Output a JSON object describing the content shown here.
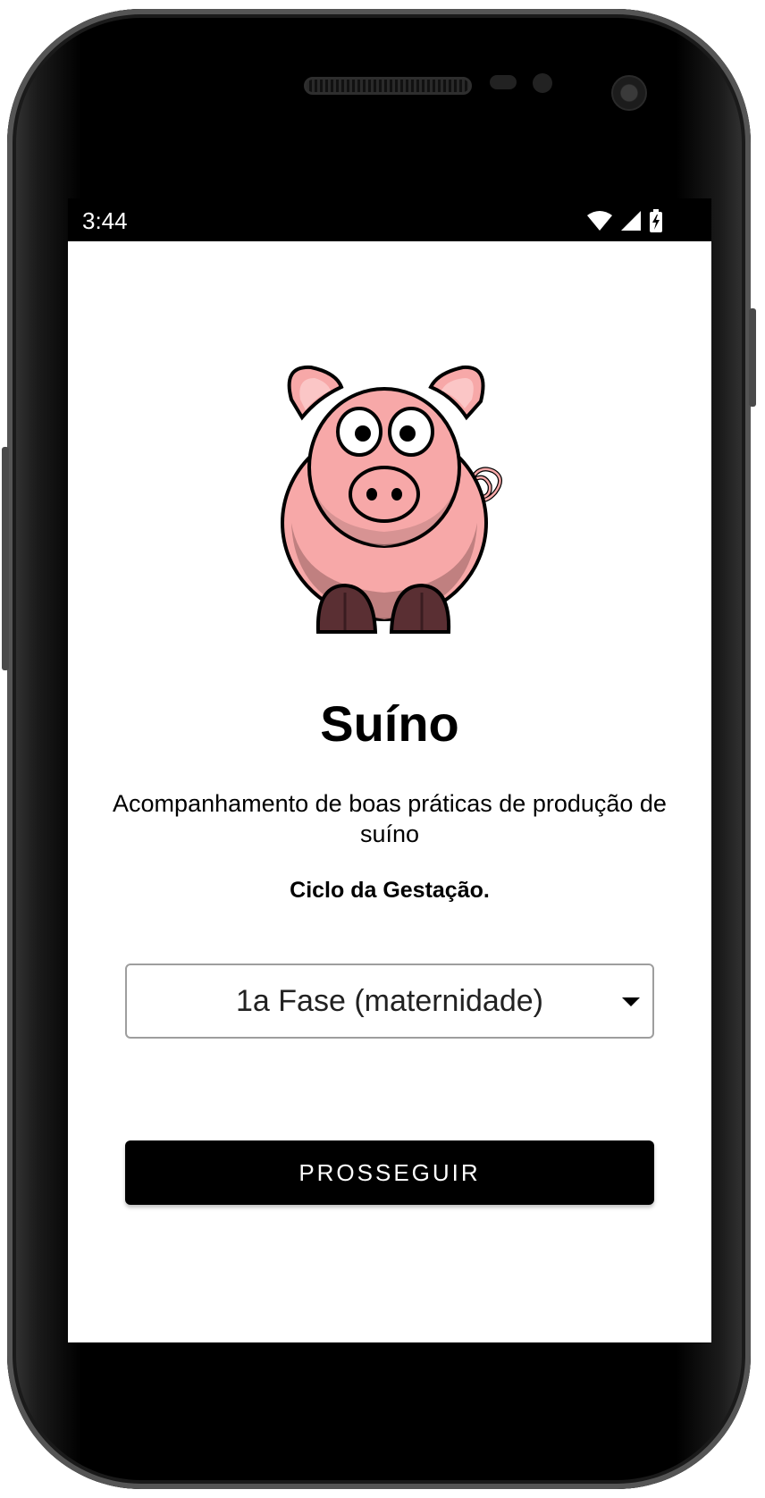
{
  "status_bar": {
    "time": "3:44",
    "icons": [
      "wifi-icon",
      "cellular-signal-icon",
      "battery-charging-icon"
    ]
  },
  "logo": {
    "icon": "pig-icon"
  },
  "main": {
    "title": "Suíno",
    "subtitle": "Acompanhamento de boas práticas de produção de suíno",
    "cycle_label": "Ciclo da Gestação.",
    "phase_select": {
      "selected": "1a Fase (maternidade)"
    },
    "proceed_label": "PROSSEGUIR"
  },
  "colors": {
    "primary": "#000000",
    "background": "#ffffff",
    "pig_body": "#f7a8a8",
    "pig_shade": "#b97b7b",
    "pig_hoof": "#5a2f33"
  }
}
